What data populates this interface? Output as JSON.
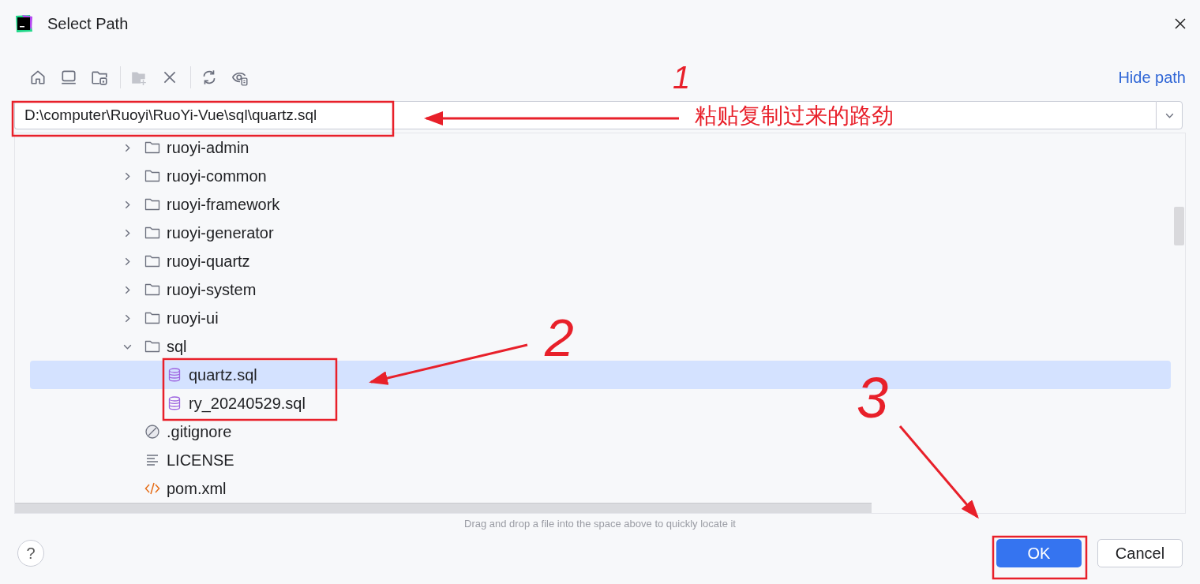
{
  "window": {
    "title": "Select Path"
  },
  "toolbar": [
    {
      "kind": "home",
      "disabled": false
    },
    {
      "kind": "desktop",
      "disabled": false
    },
    {
      "kind": "project",
      "disabled": false
    },
    {
      "kind": "new-folder",
      "disabled": true
    },
    {
      "kind": "delete",
      "disabled": false
    },
    {
      "kind": "refresh",
      "disabled": false
    },
    {
      "kind": "show-hidden",
      "disabled": false
    }
  ],
  "hide_path_link": "Hide path",
  "path_field": {
    "value": "D:\\computer\\Ruoyi\\RuoYi-Vue\\sql\\quartz.sql"
  },
  "tree": {
    "items": [
      {
        "name": "ruoyi-admin",
        "kind": "folder",
        "expanded": false,
        "selected": false
      },
      {
        "name": "ruoyi-common",
        "kind": "folder",
        "expanded": false,
        "selected": false
      },
      {
        "name": "ruoyi-framework",
        "kind": "folder",
        "expanded": false,
        "selected": false
      },
      {
        "name": "ruoyi-generator",
        "kind": "folder",
        "expanded": false,
        "selected": false
      },
      {
        "name": "ruoyi-quartz",
        "kind": "folder",
        "expanded": false,
        "selected": false
      },
      {
        "name": "ruoyi-system",
        "kind": "folder",
        "expanded": false,
        "selected": false
      },
      {
        "name": "ruoyi-ui",
        "kind": "folder",
        "expanded": false,
        "selected": false
      },
      {
        "name": "sql",
        "kind": "folder",
        "expanded": true,
        "selected": false,
        "children": [
          {
            "name": "quartz.sql",
            "kind": "sql",
            "selected": true
          },
          {
            "name": "ry_20240529.sql",
            "kind": "sql",
            "selected": false
          }
        ]
      },
      {
        "name": ".gitignore",
        "kind": "ignore",
        "selected": false
      },
      {
        "name": "LICENSE",
        "kind": "text",
        "selected": false
      },
      {
        "name": "pom.xml",
        "kind": "xml",
        "selected": false
      }
    ]
  },
  "hint": "Drag and drop a file into the space above to quickly locate it",
  "buttons": {
    "help": "?",
    "ok": "OK",
    "cancel": "Cancel"
  },
  "annotations": {
    "label": "粘贴复制过来的路劲",
    "marks": [
      "1",
      "2",
      "3"
    ]
  }
}
